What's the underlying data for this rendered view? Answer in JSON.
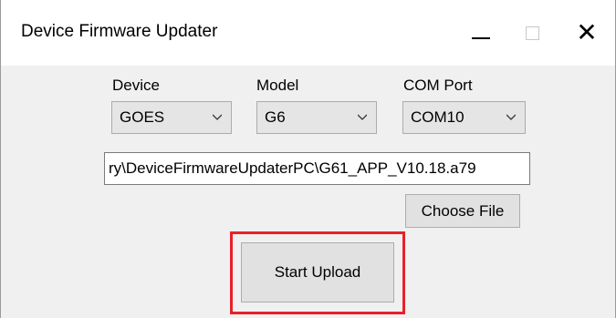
{
  "window": {
    "title": "Device Firmware Updater"
  },
  "titlebar_controls": {
    "minimize_icon": "minimize-icon",
    "maximize_icon": "maximize-icon",
    "close_icon": "close-icon",
    "close_glyph": "✕"
  },
  "form": {
    "device": {
      "label": "Device",
      "value": "GOES"
    },
    "model": {
      "label": "Model",
      "value": "G6"
    },
    "com_port": {
      "label": "COM Port",
      "value": "COM10"
    },
    "file_path": "ry\\DeviceFirmwareUpdaterPC\\G61_APP_V10.18.a79",
    "choose_file_label": "Choose File",
    "start_upload_label": "Start Upload"
  },
  "colors": {
    "highlight": "#e8202a"
  }
}
